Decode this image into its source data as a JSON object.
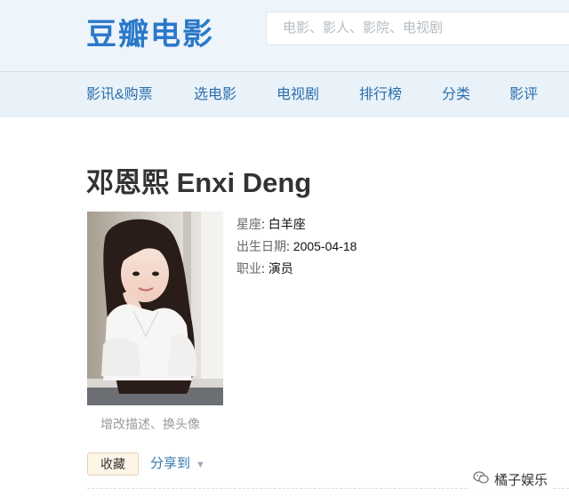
{
  "header": {
    "logo": "豆瓣电影",
    "search_placeholder": "电影、影人、影院、电视剧"
  },
  "nav": {
    "items": [
      {
        "label": "影讯&购票"
      },
      {
        "label": "选电影"
      },
      {
        "label": "电视剧"
      },
      {
        "label": "排行榜"
      },
      {
        "label": "分类"
      },
      {
        "label": "影评"
      }
    ]
  },
  "profile": {
    "name": "邓恩熙 Enxi Deng",
    "photo_caption": "增改描述、换头像",
    "info": [
      {
        "label": "星座",
        "value": "白羊座"
      },
      {
        "label": "出生日期",
        "value": "2005-04-18"
      },
      {
        "label": "职业",
        "value": "演员"
      }
    ]
  },
  "actions": {
    "collect_label": "收藏",
    "share_label": "分享到"
  },
  "watermark": {
    "text": "橘子娱乐",
    "icon": "wechat-icon"
  },
  "colors": {
    "brand": "#2a78c9",
    "nav_link": "#2b6fac",
    "header_bg": "#edf4fa"
  }
}
